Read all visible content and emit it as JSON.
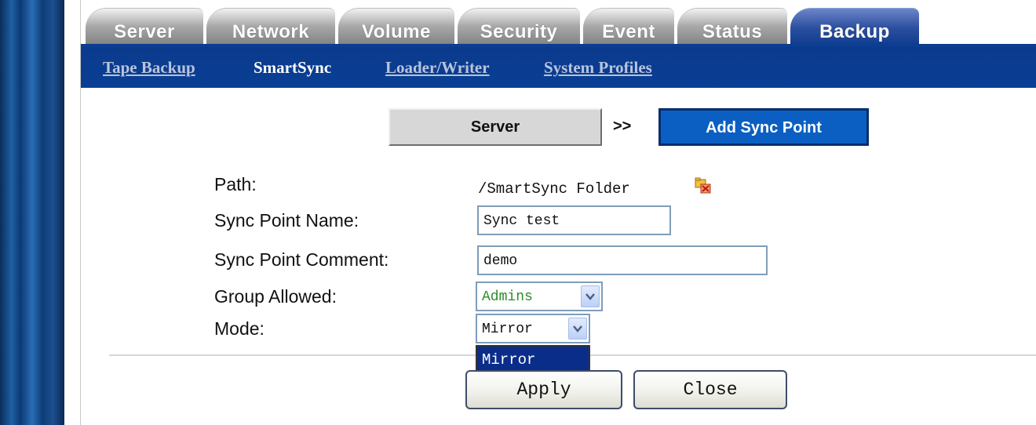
{
  "tabs": [
    {
      "label": "Server",
      "active": false
    },
    {
      "label": "Network",
      "active": false
    },
    {
      "label": "Volume",
      "active": false
    },
    {
      "label": "Security",
      "active": false
    },
    {
      "label": "Event",
      "active": false
    },
    {
      "label": "Status",
      "active": false
    },
    {
      "label": "Backup",
      "active": true
    }
  ],
  "subnav": [
    {
      "label": "Tape Backup",
      "current": false
    },
    {
      "label": "SmartSync",
      "current": true
    },
    {
      "label": "Loader/Writer",
      "current": false
    },
    {
      "label": "System Profiles",
      "current": false
    }
  ],
  "steps": {
    "server": "Server",
    "arrow": ">>",
    "current": "Add Sync Point"
  },
  "form": {
    "path_label": "Path:",
    "path_value": "/SmartSync Folder",
    "name_label": "Sync Point Name:",
    "name_value": "Sync test",
    "comment_label": "Sync Point Comment:",
    "comment_value": "demo",
    "group_label": "Group Allowed:",
    "group_value": "Admins",
    "mode_label": "Mode:",
    "mode_value": "Mirror",
    "mode_options": [
      "Mirror"
    ]
  },
  "buttons": {
    "apply": "Apply",
    "close": "Close"
  },
  "colors": {
    "brand_blue": "#0a3a8c",
    "active_step": "#0b5fc2",
    "group_text": "#2e8b2e",
    "dropdown_highlight": "#0a2d8a"
  },
  "icons": {
    "path_browse": "folder-browse-icon",
    "select_arrow": "chevron-down-icon"
  }
}
